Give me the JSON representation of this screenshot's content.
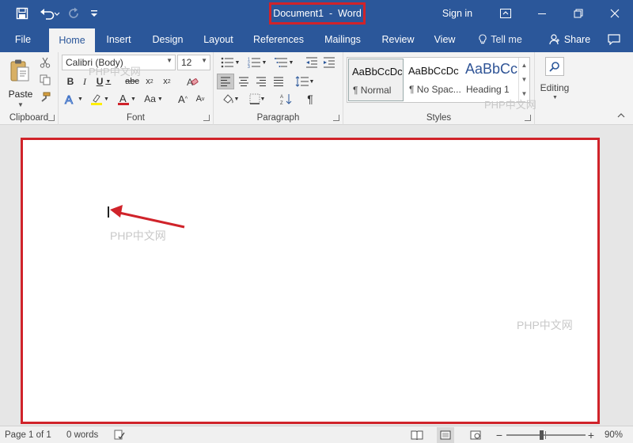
{
  "titlebar": {
    "doc_title": "Document1  -  Word",
    "signin_label": "Sign in"
  },
  "tabs": {
    "file": "File",
    "home": "Home",
    "insert": "Insert",
    "design": "Design",
    "layout": "Layout",
    "references": "References",
    "mailings": "Mailings",
    "review": "Review",
    "view": "View",
    "tell_me": "Tell me",
    "share": "Share"
  },
  "ribbon": {
    "clipboard": {
      "label": "Clipboard",
      "paste_label": "Paste"
    },
    "font": {
      "label": "Font",
      "font_name": "Calibri (Body)",
      "font_size": "12"
    },
    "paragraph": {
      "label": "Paragraph"
    },
    "styles": {
      "label": "Styles",
      "items": [
        {
          "sample": "AaBbCcDc",
          "name": "¶ Normal"
        },
        {
          "sample": "AaBbCcDc",
          "name": "¶ No Spac..."
        },
        {
          "sample": "AaBbCc",
          "name": "Heading 1"
        }
      ]
    },
    "editing": {
      "label": "Editing"
    }
  },
  "document": {
    "watermarks": [
      "PHP中文网",
      "PHP中文网",
      "PHP中文网",
      "PHP中文网"
    ]
  },
  "statusbar": {
    "page": "Page 1 of 1",
    "words": "0 words",
    "zoom": "90%",
    "zoom_level_percent": 90
  },
  "colors": {
    "word_blue": "#2b579a",
    "highlight_red": "#d0232a"
  }
}
